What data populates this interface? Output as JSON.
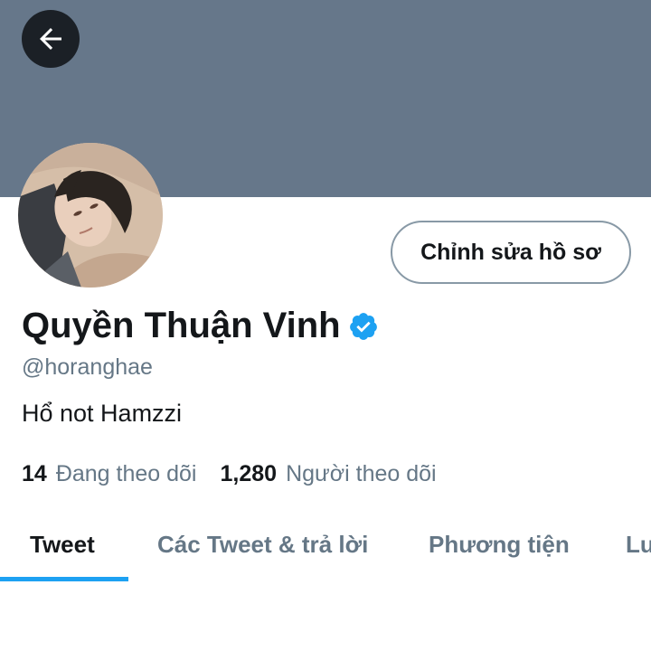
{
  "header": {
    "back_icon": "arrow-left-icon"
  },
  "profile": {
    "display_name": "Quyền Thuận Vinh",
    "verified_icon": "verified-badge-icon",
    "handle": "@horanghae",
    "bio": "Hổ not Hamzzi",
    "edit_button_label": "Chỉnh sửa hồ sơ",
    "following_count": "14",
    "following_label": "Đang theo dõi",
    "followers_count": "1,280",
    "followers_label": "Người theo dõi"
  },
  "tabs": [
    {
      "label": "Tweet",
      "active": true
    },
    {
      "label": "Các Tweet & trả lời",
      "active": false
    },
    {
      "label": "Phương tiện",
      "active": false
    },
    {
      "label": "Lượt thích",
      "active": false
    }
  ],
  "colors": {
    "banner": "#66778a",
    "accent": "#1da1f2",
    "text_primary": "#14171a",
    "text_secondary": "#657786"
  }
}
